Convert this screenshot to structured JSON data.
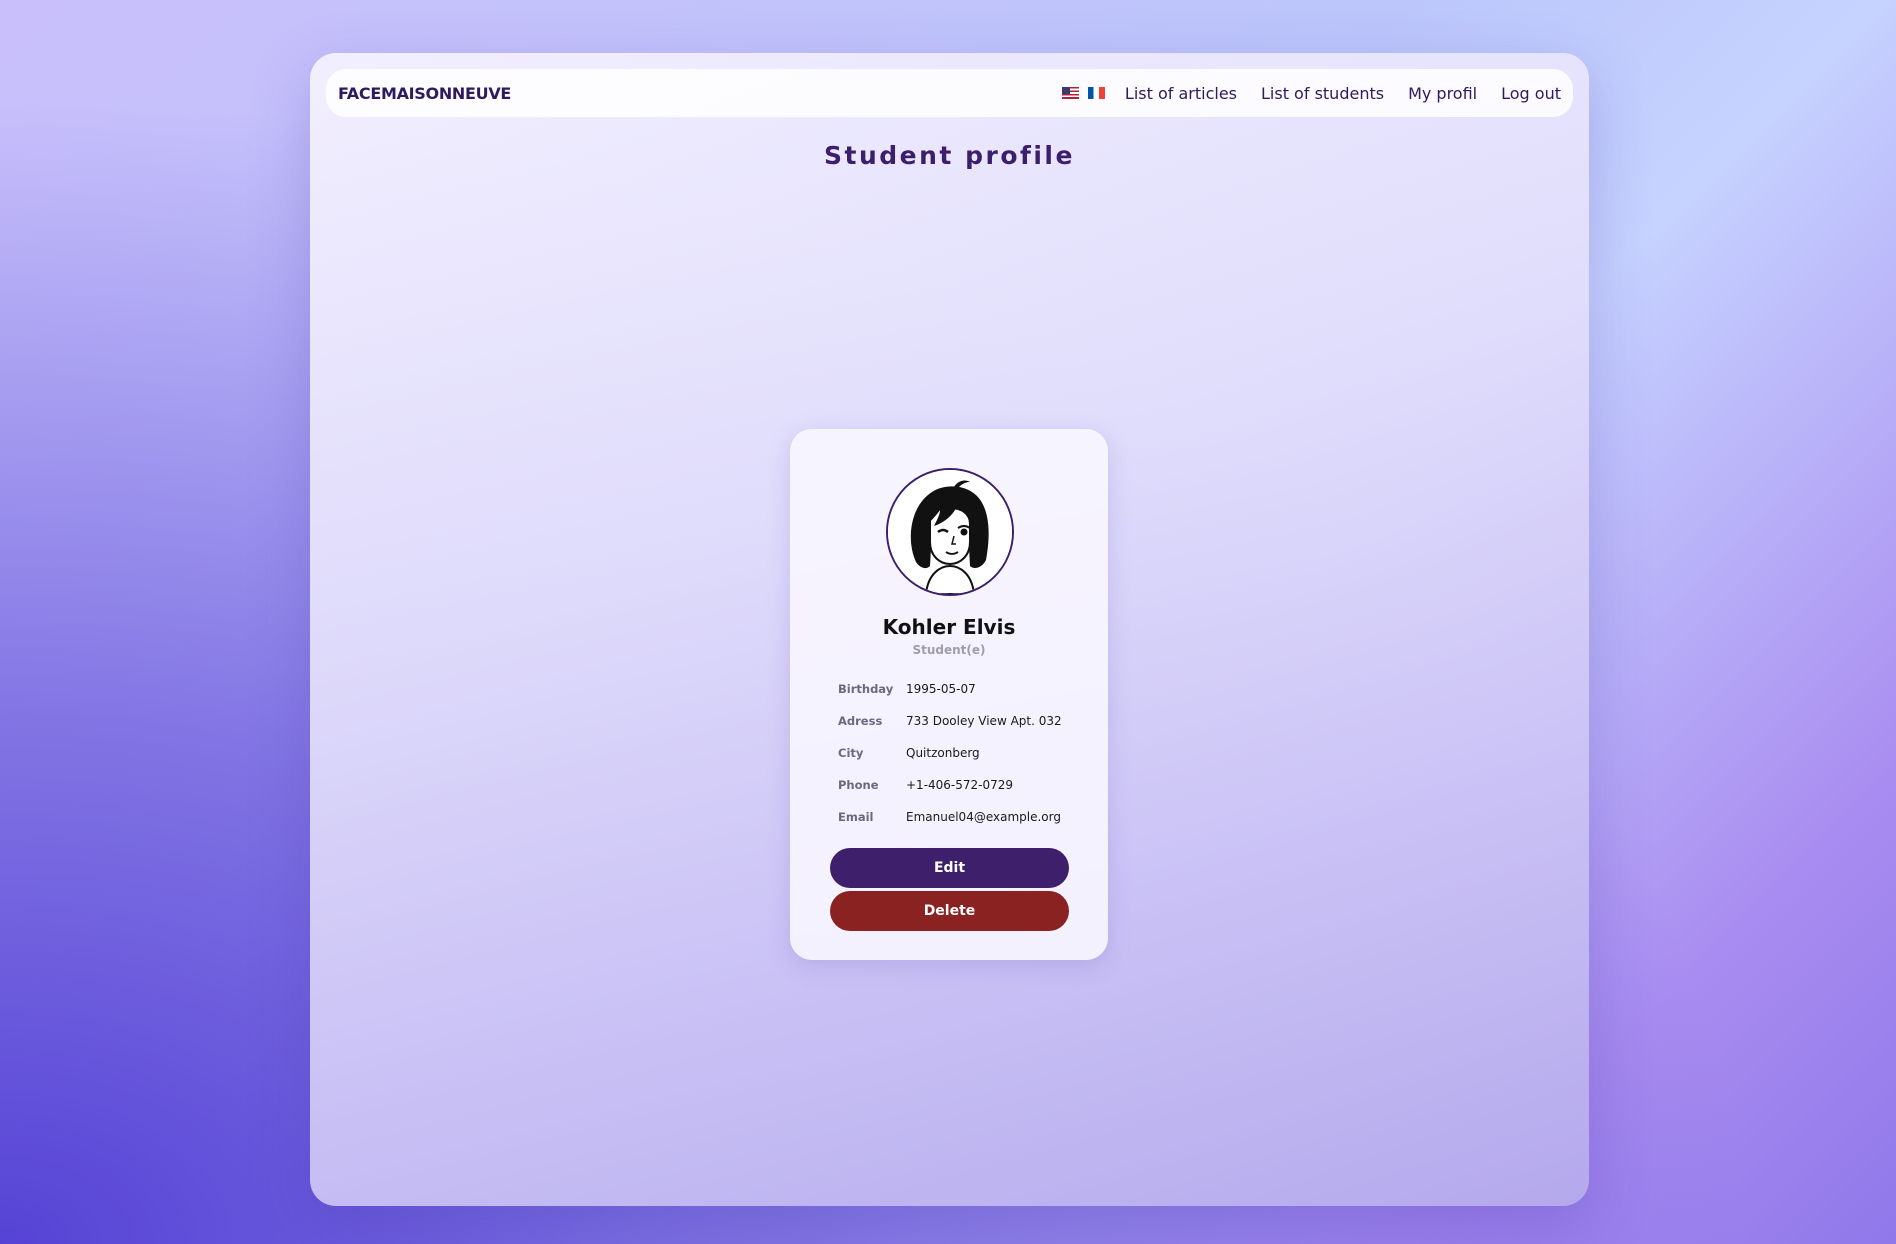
{
  "navbar": {
    "brand": "FACEMAISONNEUVE",
    "flags": [
      "us-flag-icon",
      "fr-flag-icon"
    ],
    "links": [
      "List of articles",
      "List of students",
      "My profil",
      "Log out"
    ]
  },
  "page": {
    "title": "Student profile"
  },
  "profile": {
    "avatar_icon": "student-avatar-illustration",
    "name": "Kohler Elvis",
    "role": "Student(e)",
    "fields": [
      {
        "label": "Birthday",
        "value": "1995-05-07"
      },
      {
        "label": "Adress",
        "value": "733 Dooley View Apt. 032"
      },
      {
        "label": "City",
        "value": "Quitzonberg"
      },
      {
        "label": "Phone",
        "value": "+1-406-572-0729"
      },
      {
        "label": "Email",
        "value": "Emanuel04@example.org"
      }
    ],
    "edit_label": "Edit",
    "delete_label": "Delete"
  },
  "colors": {
    "primary": "#3d1f6b",
    "danger": "#8b2222",
    "title": "#3b1f6b"
  }
}
